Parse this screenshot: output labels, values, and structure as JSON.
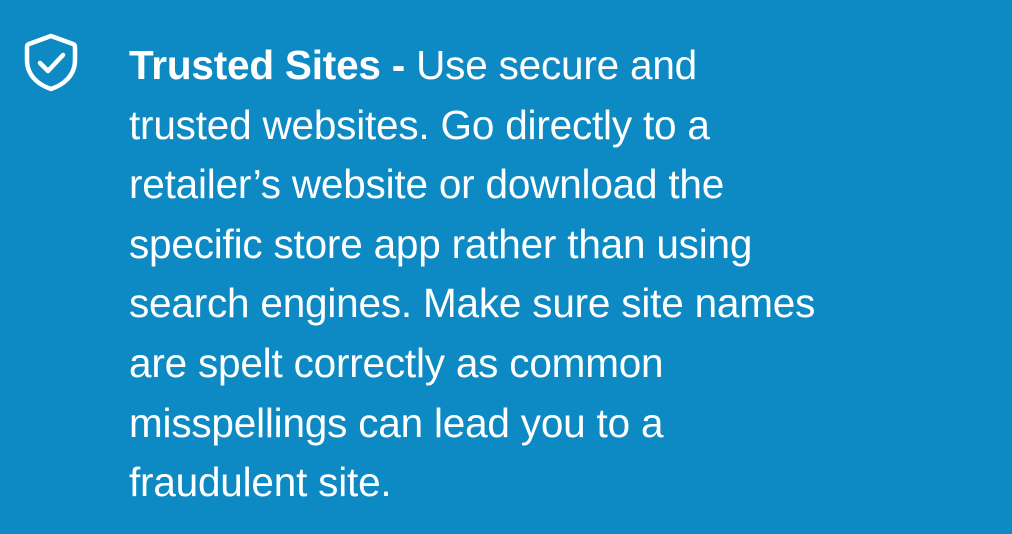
{
  "tip": {
    "icon": "shield-check-icon",
    "heading": "Trusted Sites - ",
    "body": "Use secure and\ntrusted websites. Go directly to a\nretailer’s website or download the\nspecific store app rather than using\nsearch engines. Make sure site names\nare spelt correctly as common\nmisspellings can lead you to a\nfraudulent site."
  },
  "colors": {
    "background": "#0d8ac4",
    "text": "#ffffff"
  }
}
